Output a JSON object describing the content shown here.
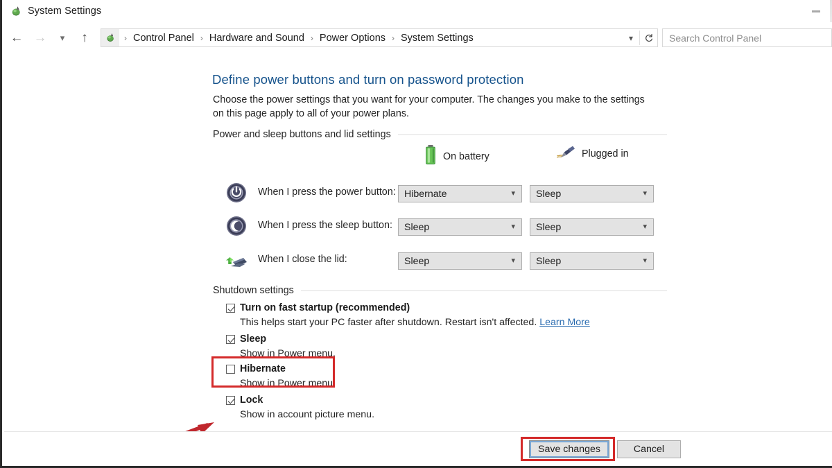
{
  "window": {
    "title": "System Settings",
    "app_icon": "power-options-icon",
    "minimize_label": "Minimize"
  },
  "navbar": {
    "back_icon": "back-arrow-icon",
    "forward_icon": "forward-arrow-icon",
    "recent_icon": "chevron-down-icon",
    "up_icon": "up-arrow-icon",
    "breadcrumb": [
      "Control Panel",
      "Hardware and Sound",
      "Power Options",
      "System Settings"
    ],
    "separator": "›",
    "dropdown_icon": "chevron-down-icon",
    "refresh_icon": "refresh-icon",
    "search": {
      "placeholder": "Search Control Panel",
      "value": ""
    }
  },
  "page": {
    "heading": "Define power buttons and turn on password protection",
    "description": "Choose the power settings that you want for your computer. The changes you make to the settings on this page apply to all of your power plans."
  },
  "power_section": {
    "title": "Power and sleep buttons and lid settings",
    "columns": [
      {
        "label": "On battery",
        "icon": "battery-icon"
      },
      {
        "label": "Plugged in",
        "icon": "power-plug-icon"
      }
    ],
    "rows": [
      {
        "icon": "power-button-icon",
        "label": "When I press the power button:",
        "on_battery": "Hibernate",
        "plugged_in": "Sleep"
      },
      {
        "icon": "sleep-moon-icon",
        "label": "When I press the sleep button:",
        "on_battery": "Sleep",
        "plugged_in": "Sleep"
      },
      {
        "icon": "laptop-lid-icon",
        "label": "When I close the lid:",
        "on_battery": "Sleep",
        "plugged_in": "Sleep"
      }
    ],
    "dropdown_arrow": "⌄"
  },
  "shutdown_section": {
    "title": "Shutdown settings",
    "items": [
      {
        "label": "Turn on fast startup (recommended)",
        "checked": true,
        "sub": "This helps start your PC faster after shutdown. Restart isn't affected.",
        "link": "Learn More"
      },
      {
        "label": "Sleep",
        "checked": true,
        "sub": "Show in Power menu.",
        "link": ""
      },
      {
        "label": "Hibernate",
        "checked": false,
        "sub": "Show in Power menu.",
        "link": ""
      },
      {
        "label": "Lock",
        "checked": true,
        "sub": "Show in account picture menu.",
        "link": ""
      }
    ]
  },
  "footer": {
    "save_label": "Save changes",
    "cancel_label": "Cancel"
  },
  "annotations": {
    "highlight_color": "#d42a2a",
    "arrow_color": "#c0272d",
    "highlighted_items": [
      "Hibernate",
      "Save changes"
    ]
  },
  "colors": {
    "heading": "#16538c",
    "link": "#2b6cb0",
    "button_face": "#e3e3e3",
    "focus_ring": "#7aa7d4",
    "battery_green": "#5bb85b"
  }
}
